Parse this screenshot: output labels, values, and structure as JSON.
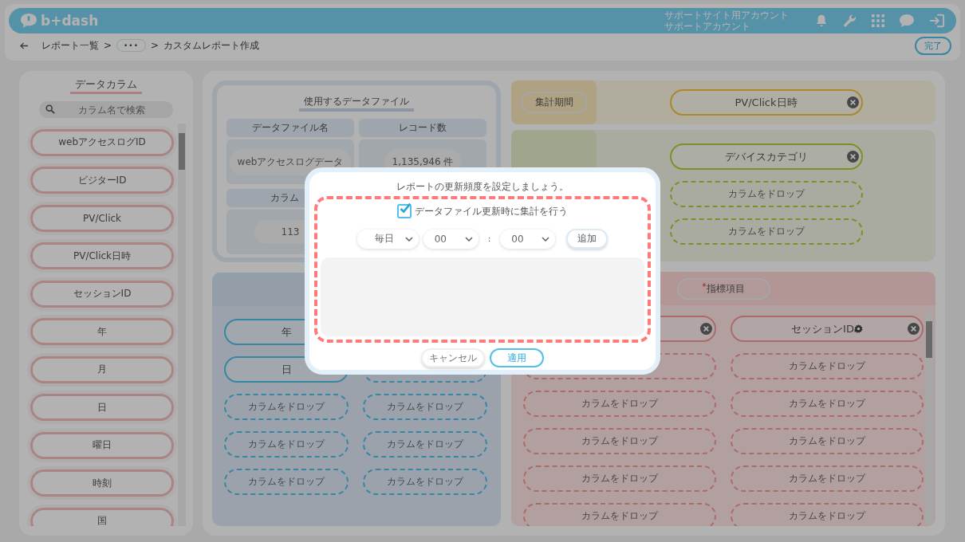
{
  "header": {
    "logo": "b+dash",
    "account_lines": [
      "サポートサイト用アカウント",
      "サポートアカウント"
    ]
  },
  "breadcrumb": {
    "items": [
      {
        "kind": "link",
        "label": "レポート一覧"
      },
      {
        "kind": "sep",
        "label": ">"
      },
      {
        "kind": "more",
        "label": "•••"
      },
      {
        "kind": "sep",
        "label": ">"
      },
      {
        "kind": "current",
        "label": "カスタムレポート作成"
      }
    ],
    "done_button": "完了"
  },
  "columns_panel": {
    "title": "データカラム",
    "search": {
      "placeholder": "カラム名で検索"
    },
    "items": [
      "webアクセスログID",
      "ビジターID",
      "PV/Click",
      "PV/Click日時",
      "セッションID",
      "年",
      "月",
      "日",
      "曜日",
      "時刻",
      "国"
    ]
  },
  "data_file": {
    "title": "使用するデータファイル",
    "cells": [
      {
        "heading": "データファイル名",
        "value": "webアクセスログデータ"
      },
      {
        "heading": "レコード数",
        "value": "1,135,946 件"
      },
      {
        "heading": "カラム",
        "value": "113"
      }
    ]
  },
  "period": {
    "label": "集計期間",
    "chips": [
      {
        "kind": "chip",
        "label": "PV/Click日時",
        "removable": true
      }
    ]
  },
  "filter": {
    "chips": [
      {
        "kind": "chip",
        "label": "デバイスカテゴリ",
        "removable": true
      },
      {
        "kind": "drop",
        "label": "カラムをドロップ"
      },
      {
        "kind": "drop",
        "label": "カラムをドロップ"
      }
    ]
  },
  "dimensions": {
    "columns": [
      {
        "chips": [
          {
            "kind": "chip",
            "label": "年"
          },
          {
            "kind": "chip",
            "label": "日"
          },
          {
            "kind": "drop",
            "label": "カラムをドロップ"
          },
          {
            "kind": "drop",
            "label": "カラムをドロップ"
          },
          {
            "kind": "drop",
            "label": "カラムをドロップ"
          }
        ]
      },
      {
        "chips": [
          {
            "kind": "drop"
          },
          {
            "kind": "drop",
            "label": "カラムをドロップ"
          },
          {
            "kind": "drop",
            "label": "カラムをドロップ"
          },
          {
            "kind": "drop",
            "label": "カラムをドロップ"
          }
        ]
      }
    ]
  },
  "metrics": {
    "required_mark": "*",
    "label": "指標項目",
    "chips": [
      {
        "kind": "chip",
        "removable": true
      },
      {
        "kind": "chip",
        "label": "セッションID",
        "removable": true,
        "settings": true
      },
      {
        "kind": "drop"
      },
      {
        "kind": "drop",
        "label": "カラムをドロップ"
      },
      {
        "kind": "drop",
        "label": "カラムをドロップ"
      },
      {
        "kind": "drop",
        "label": "カラムをドロップ"
      },
      {
        "kind": "drop",
        "label": "カラムをドロップ"
      },
      {
        "kind": "drop",
        "label": "カラムをドロップ"
      },
      {
        "kind": "drop",
        "label": "カラムをドロップ"
      },
      {
        "kind": "drop",
        "label": "カラムをドロップ"
      },
      {
        "kind": "drop",
        "label": "カラムをドロップ"
      },
      {
        "kind": "drop",
        "label": "カラムをドロップ"
      }
    ]
  },
  "modal": {
    "message": "レポートの更新頻度を設定しましょう。",
    "checkbox": {
      "label": "データファイル更新時に集計を行う",
      "checked": true
    },
    "selects": [
      {
        "value": "毎日"
      },
      {
        "value": "00"
      },
      {
        "value": "00"
      }
    ],
    "time_separator": ":",
    "add_button": "追加",
    "buttons": [
      {
        "kind": "secondary",
        "label": "キャンセル"
      },
      {
        "kind": "primary",
        "label": "適用"
      }
    ]
  }
}
